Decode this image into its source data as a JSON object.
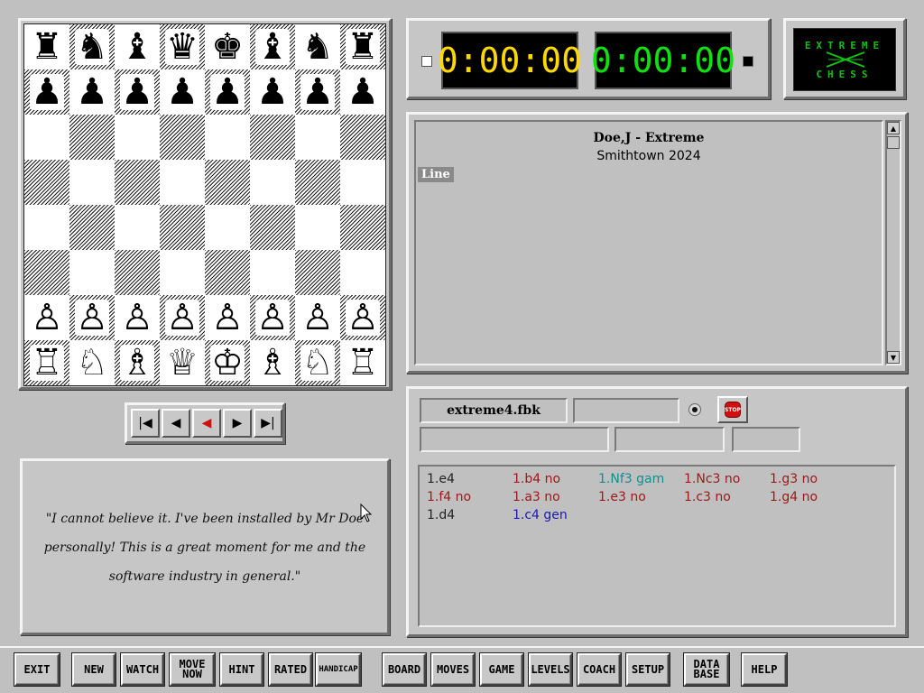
{
  "board": {
    "rows": [
      [
        "♜",
        "♞",
        "♝",
        "♛",
        "♚",
        "♝",
        "♞",
        "♜"
      ],
      [
        "♟",
        "♟",
        "♟",
        "♟",
        "♟",
        "♟",
        "♟",
        "♟"
      ],
      [
        "",
        "",
        "",
        "",
        "",
        "",
        "",
        ""
      ],
      [
        "",
        "",
        "",
        "",
        "",
        "",
        "",
        ""
      ],
      [
        "",
        "",
        "",
        "",
        "",
        "",
        "",
        ""
      ],
      [
        "",
        "",
        "",
        "",
        "",
        "",
        "",
        ""
      ],
      [
        "♙",
        "♙",
        "♙",
        "♙",
        "♙",
        "♙",
        "♙",
        "♙"
      ],
      [
        "♖",
        "♘",
        "♗",
        "♕",
        "♔",
        "♗",
        "♘",
        "♖"
      ]
    ]
  },
  "navigation": {
    "first_icon": "|◀",
    "back_icon": "◀",
    "stop_icon": "◀",
    "forward_icon": "▶",
    "last_icon": "▶|"
  },
  "quote": "\"I cannot believe it. I've been installed by Mr Doe personally! This is a great moment for me and the software industry in general.\"",
  "clocks": {
    "white": "0:00:00",
    "black": "0:00:00",
    "white_color": "#ffd800",
    "black_color": "#10e010"
  },
  "logo": {
    "line1": "EXTREME",
    "line2": "CHESS",
    "color": "#15c015"
  },
  "game_info": {
    "players": "Doe,J - Extreme",
    "event": "Smithtown 2024",
    "line_label": "Line"
  },
  "book": {
    "filename": "extreme4.fbk",
    "stop_label": "STOP",
    "moves": [
      {
        "text": "1.e4",
        "color": "#222222"
      },
      {
        "text": "1.b4 no",
        "color": "#a01818"
      },
      {
        "text": "1.Nf3 gam",
        "color": "#0e8f8f"
      },
      {
        "text": "1.Nc3 no",
        "color": "#a01818"
      },
      {
        "text": "1.g3 no",
        "color": "#a01818"
      },
      {
        "text": "1.f4 no",
        "color": "#a01818"
      },
      {
        "text": "1.a3 no",
        "color": "#a01818"
      },
      {
        "text": "1.e3 no",
        "color": "#a01818"
      },
      {
        "text": "1.c3 no",
        "color": "#a01818"
      },
      {
        "text": "1.g4 no",
        "color": "#a01818"
      },
      {
        "text": "1.d4",
        "color": "#222222"
      },
      {
        "text": "1.c4 gen",
        "color": "#1a1ab0"
      }
    ]
  },
  "toolbar": {
    "exit": "EXIT",
    "new": "NEW",
    "watch": "WATCH",
    "move_now": "MOVE NOW",
    "hint": "HINT",
    "rated": "RATED",
    "handicap": "HANDICAP",
    "board": "BOARD",
    "moves": "MOVES",
    "game": "GAME",
    "levels": "LEVELS",
    "coach": "COACH",
    "setup": "SETUP",
    "database": "DATA BASE",
    "help": "HELP"
  }
}
